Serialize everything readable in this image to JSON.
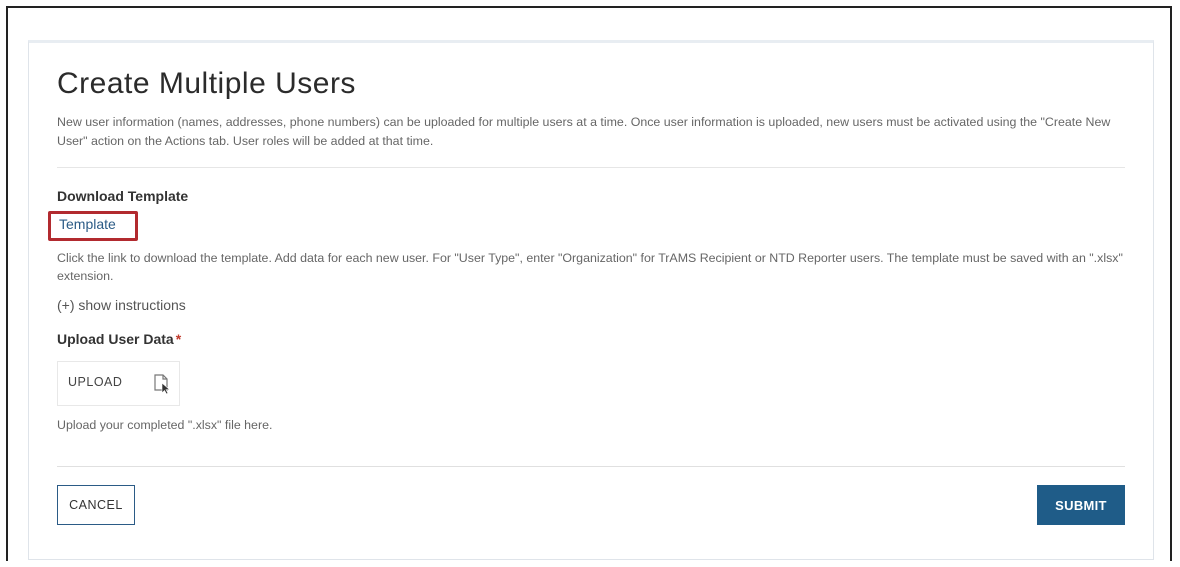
{
  "page": {
    "title": "Create Multiple Users",
    "description": "New user information (names, addresses, phone numbers) can be uploaded for multiple users at a time. Once user information is uploaded, new users must be activated using the \"Create New User\" action on the Actions tab. User roles will be added at that time."
  },
  "download": {
    "heading": "Download Template",
    "link_label": "Template",
    "hint": "Click the link to download the template. Add data for each new user. For \"User Type\", enter \"Organization\" for TrAMS Recipient or NTD Reporter users. The template must be saved with an \".xlsx\" extension.",
    "highlight_color": "#b22a2f"
  },
  "instructions": {
    "toggle_label": "(+) show instructions"
  },
  "upload": {
    "heading": "Upload User Data",
    "required_mark": "*",
    "button_label": "UPLOAD",
    "icon": "file-cursor-icon",
    "hint": "Upload your completed \".xlsx\" file here."
  },
  "actions": {
    "cancel_label": "CANCEL",
    "submit_label": "SUBMIT",
    "accent_color": "#1f5c88"
  }
}
